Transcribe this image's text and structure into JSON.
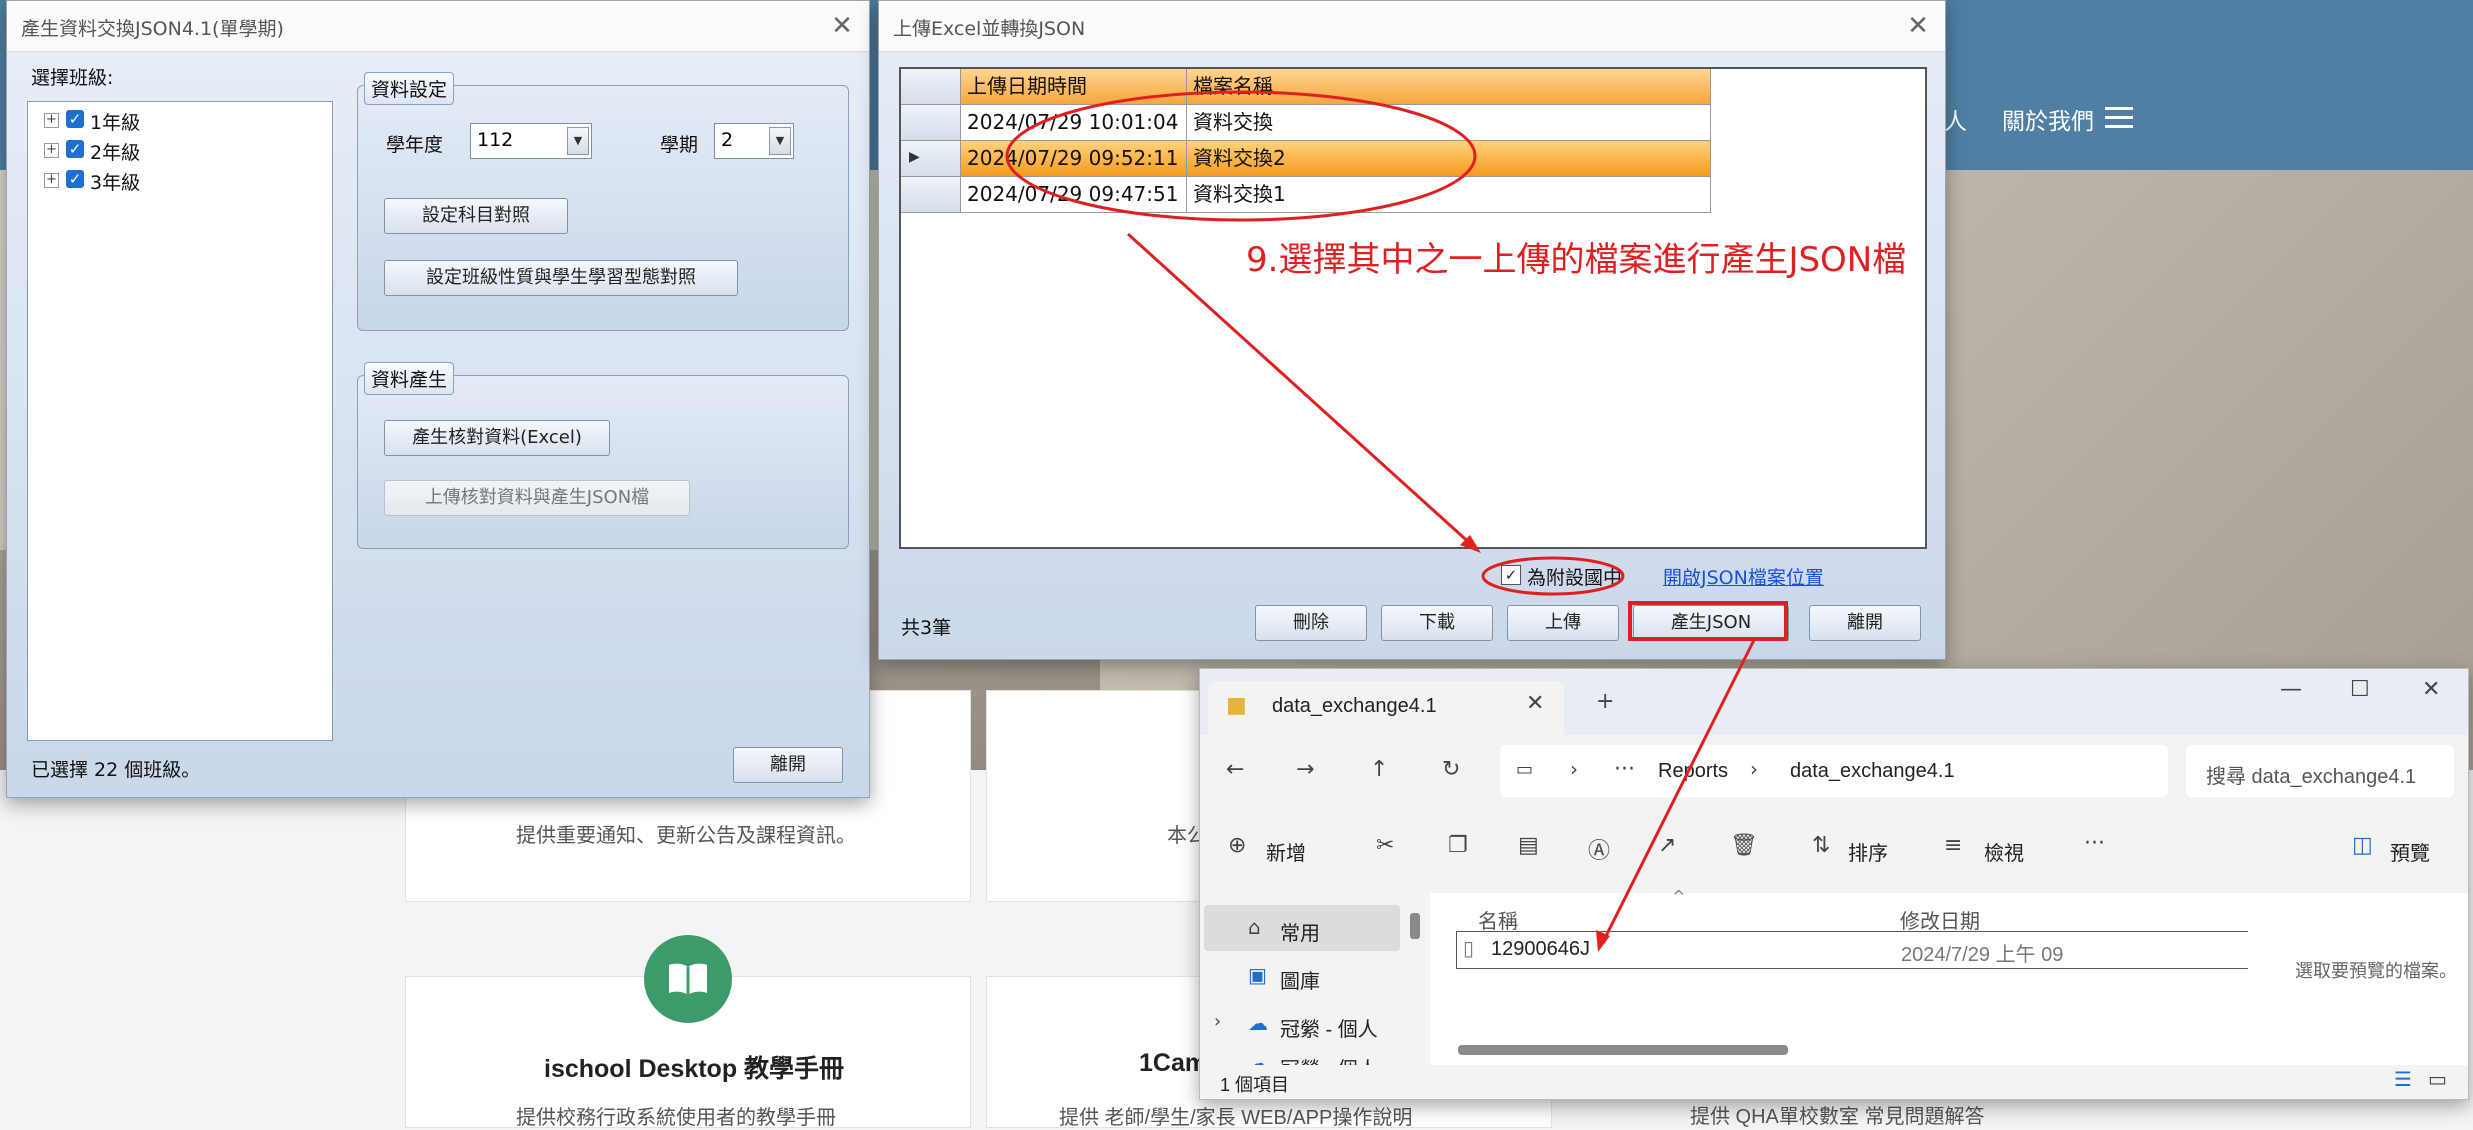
{
  "website": {
    "nav_items": [
      "人",
      "關於我們"
    ],
    "cards": {
      "card1_text": "提供重要通知、更新公告及課程資訊。",
      "card2_text": "本公",
      "card3_title": "ischool Desktop 教學手冊",
      "card3_text": "提供校務行政系統使用者的教學手冊",
      "card4_title": "1Cam",
      "card4_text": "提供 老師/學生/家長 WEB/APP操作說明",
      "card5_text": "提供 QHA單校數室 常見問題解答"
    },
    "accent_color": "#3d9a6b"
  },
  "left_window": {
    "title": "產生資料交換JSON4.1(單學期)",
    "class_label": "選擇班級:",
    "tree": [
      {
        "label": "1年級",
        "checked": true
      },
      {
        "label": "2年級",
        "checked": true
      },
      {
        "label": "3年級",
        "checked": true
      }
    ],
    "settings_group": "資料設定",
    "year_label": "學年度",
    "year_value": "112",
    "semester_label": "學期",
    "semester_value": "2",
    "btn_subject_map": "設定科目對照",
    "btn_class_map": "設定班級性質與學生學習型態對照",
    "generate_group": "資料產生",
    "btn_generate_excel": "產生核對資料(Excel)",
    "btn_upload_json": "上傳核對資料與產生JSON檔",
    "status": "已選擇 22 個班級。",
    "btn_close": "離開"
  },
  "middle_window": {
    "title": "上傳Excel並轉換JSON",
    "columns": [
      "上傳日期時間",
      "檔案名稱"
    ],
    "rows": [
      {
        "datetime": "2024/07/29 10:01:04",
        "name": "資料交換",
        "selected": false
      },
      {
        "datetime": "2024/07/29 09:52:11",
        "name": "資料交換2",
        "selected": true
      },
      {
        "datetime": "2024/07/29 09:47:51",
        "name": "資料交換1",
        "selected": false
      }
    ],
    "annotation": "9.選擇其中之一上傳的檔案進行產生JSON檔",
    "checkbox_label": "為附設國中",
    "checkbox_checked": true,
    "link_open_json": "開啟JSON檔案位置",
    "count": "共3筆",
    "btn_delete": "刪除",
    "btn_download": "下載",
    "btn_upload": "上傳",
    "btn_generate_json": "產生JSON",
    "btn_close": "離開",
    "highlight_color": "#e02020"
  },
  "explorer": {
    "tab_title": "data_exchange4.1",
    "breadcrumb": [
      "Reports",
      "data_exchange4.1"
    ],
    "search_placeholder": "搜尋 data_exchange4.1",
    "toolbar": {
      "new": "新增",
      "sort": "排序",
      "view": "檢視",
      "preview": "預覽"
    },
    "nav": [
      {
        "label": "常用",
        "icon": "home-icon"
      },
      {
        "label": "圖庫",
        "icon": "gallery-icon"
      },
      {
        "label": "冠縈 - 個人",
        "icon": "cloud-icon"
      },
      {
        "label": "冠縈 - 個人",
        "icon": "cloud-icon"
      }
    ],
    "col_name": "名稱",
    "col_modified": "修改日期",
    "file": {
      "name": "12900646J",
      "modified": "2024/7/29 上午 09"
    },
    "preview_hint": "選取要預覽的檔案。",
    "status": "1 個項目"
  }
}
